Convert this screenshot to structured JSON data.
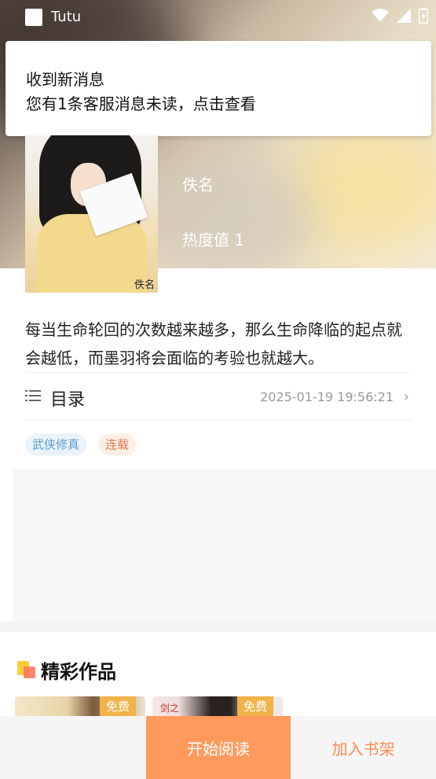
{
  "status_bar": {
    "app_name": "Tutu",
    "icons": [
      "wifi-icon",
      "signal-icon",
      "battery-icon"
    ]
  },
  "notification": {
    "title": "收到新消息",
    "body": "您有1条客服消息未读，点击查看"
  },
  "book": {
    "cover_mark": "佚名",
    "author": "佚名",
    "hot": "热度值 1",
    "synopsis": "每当生命轮回的次数越来越多，那么生命降临的起点就会越低，而墨羽将会面临的考验也就越大。"
  },
  "toc": {
    "label": "目录",
    "updated": "2025-01-19 19:56:21",
    "icon": "list-icon"
  },
  "tags": [
    "武侠修真",
    "连载"
  ],
  "section": {
    "title": "精彩作品",
    "cards": [
      {
        "badge": "免费"
      },
      {
        "badge": "免费",
        "cover_text": "剑之"
      }
    ]
  },
  "bottom_bar": {
    "read_label": "开始阅读",
    "shelf_label": "加入书架"
  },
  "colors": {
    "accent": "#ff9a5c",
    "shelf_text": "#ff8c52",
    "badge": "#f0b34a"
  }
}
